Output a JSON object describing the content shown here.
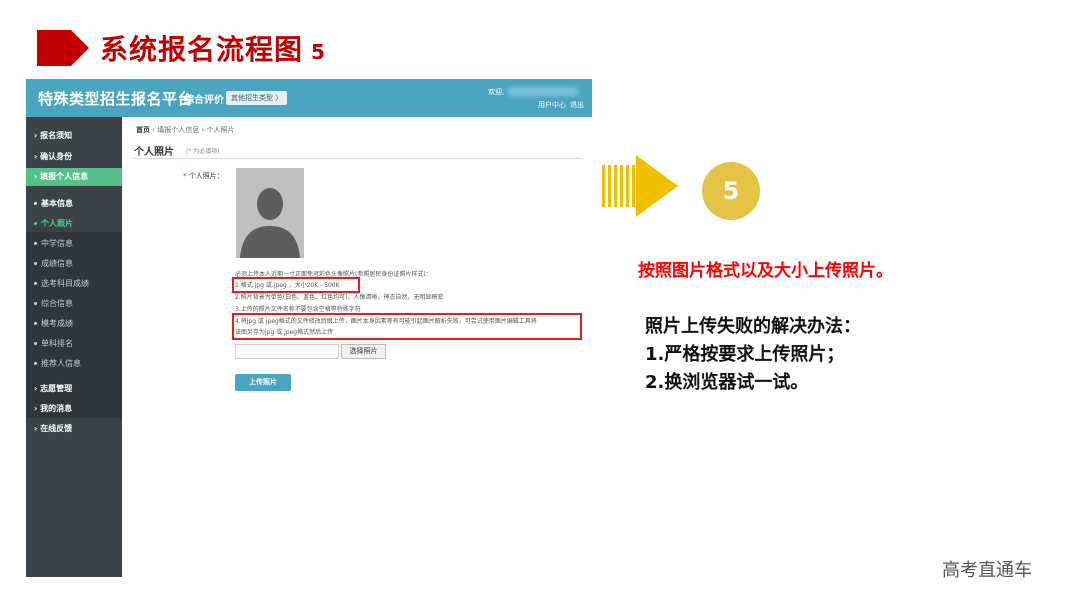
{
  "slide": {
    "title": "系统报名流程图",
    "title_number": "5",
    "step_number": "5",
    "red_note": "按照图片格式以及大小上传照片。",
    "fail_title": "照片上传失败的解决办法：",
    "fail_steps": [
      "1.严格按要求上传照片；",
      "2.换浏览器试一试。"
    ],
    "footer": "高考直通车"
  },
  "app": {
    "platform_name": "特殊类型招生报名平台",
    "eval_label": "综合评价",
    "type_button": "其他招生类型 〉",
    "welcome": "欢迎,",
    "user_center": "用户中心",
    "logout": "退出"
  },
  "sidebar": {
    "items": [
      {
        "label": "›  报名须知"
      },
      {
        "label": "›  确认身份"
      },
      {
        "label": "›  填报个人信息"
      }
    ],
    "sub_items": [
      {
        "label": "基本信息"
      },
      {
        "label": "个人照片"
      },
      {
        "label": "中学信息"
      },
      {
        "label": "成绩信息"
      },
      {
        "label": "选考科目成绩"
      },
      {
        "label": "综合信息"
      },
      {
        "label": "模考成绩"
      },
      {
        "label": "单科排名"
      },
      {
        "label": "推荐人信息"
      }
    ],
    "bottom_items": [
      {
        "label": "›  志愿管理"
      },
      {
        "label": "›  我的消息"
      },
      {
        "label": "›  在线反馈"
      }
    ]
  },
  "main": {
    "breadcrumb_home": "首页",
    "breadcrumb_mid": "填报个人信息",
    "breadcrumb_current": "个人照片",
    "section_title": "个人照片",
    "required_note": "(* 为必填项)",
    "field_label": "个人照片：",
    "requirements": [
      "必须上传本人近期一寸正面免冠彩色头像照片(参照居民身份证照片样式)：",
      "1.格式.jpg 或.jpeg ，大小20K - 500K",
      "2.照片背景为单色(白色、蓝色、红色均可)，人像清晰，神态自然，无明显畸变",
      "3.上传的照片文件名称不要包含空格等特殊字符",
      "4.将jpg 或 jpeg格式的文件修改后缀上传，图片本身因素等有可能引起图片解析失败，可尝试使用图片编辑工具将",
      "该图另存为jpg 或 jpeg格式然后上传"
    ],
    "choose_button": "选择照片",
    "upload_button": "上传照片"
  }
}
